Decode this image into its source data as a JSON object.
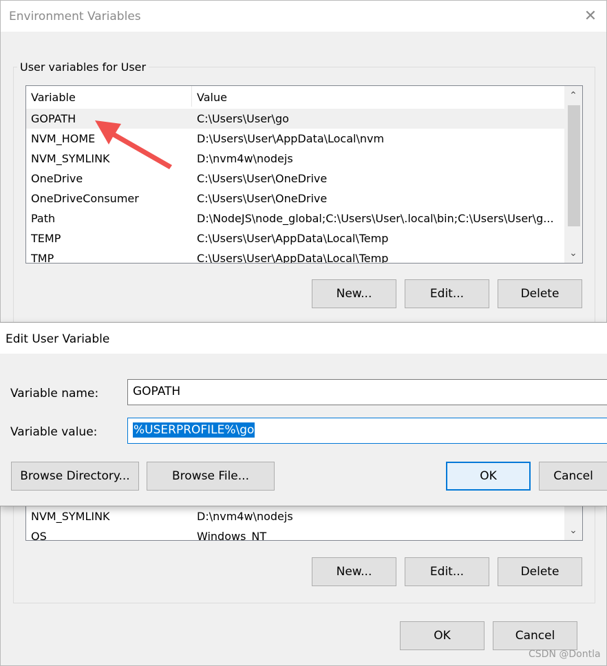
{
  "env_window": {
    "title": "Environment Variables",
    "close_symbol": "✕",
    "user_group_label": "User variables for User",
    "columns": {
      "variable": "Variable",
      "value": "Value"
    },
    "user_rows": [
      {
        "variable": "GOPATH",
        "value": "C:\\Users\\User\\go"
      },
      {
        "variable": "NVM_HOME",
        "value": "D:\\Users\\User\\AppData\\Local\\nvm"
      },
      {
        "variable": "NVM_SYMLINK",
        "value": "D:\\nvm4w\\nodejs"
      },
      {
        "variable": "OneDrive",
        "value": "C:\\Users\\User\\OneDrive"
      },
      {
        "variable": "OneDriveConsumer",
        "value": "C:\\Users\\User\\OneDrive"
      },
      {
        "variable": "Path",
        "value": "D:\\NodeJS\\node_global;C:\\Users\\User\\.local\\bin;C:\\Users\\User\\g..."
      },
      {
        "variable": "TEMP",
        "value": "C:\\Users\\User\\AppData\\Local\\Temp"
      },
      {
        "variable": "TMP",
        "value": "C:\\Users\\User\\AppData\\Local\\Temp"
      }
    ],
    "user_buttons": {
      "new": "New...",
      "edit": "Edit...",
      "delete": "Delete"
    },
    "system_rows": [
      {
        "variable": "NVM_SYMLINK",
        "value": "D:\\nvm4w\\nodejs"
      },
      {
        "variable": "OS",
        "value": "Windows_NT"
      }
    ],
    "system_buttons": {
      "new": "New...",
      "edit": "Edit...",
      "delete": "Delete"
    },
    "footer_buttons": {
      "ok": "OK",
      "cancel": "Cancel"
    },
    "scroll_up": "⌃",
    "scroll_down": "⌄"
  },
  "edit_dialog": {
    "title": "Edit User Variable",
    "name_label": "Variable name:",
    "name_value": "GOPATH",
    "value_label": "Variable value:",
    "value_value": "%USERPROFILE%\\go",
    "browse_directory": "Browse Directory...",
    "browse_file": "Browse File...",
    "ok": "OK",
    "cancel": "Cancel"
  },
  "annotation": {
    "arrow_color": "#f0524f"
  },
  "watermark": "CSDN @Dontla"
}
